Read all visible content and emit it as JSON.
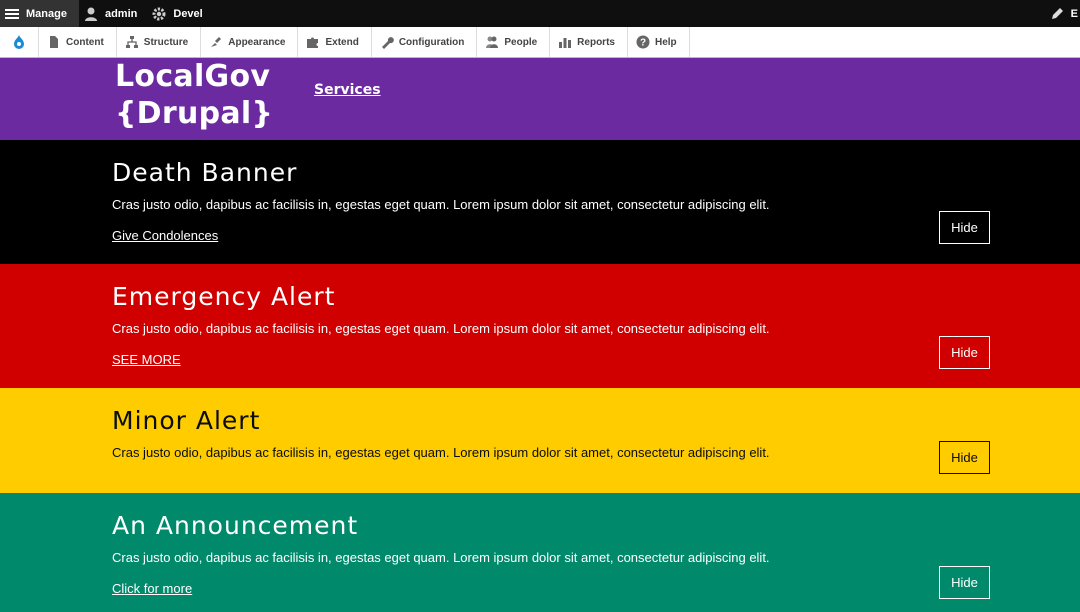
{
  "toolbar": {
    "manage_label": "Manage",
    "user_label": "admin",
    "devel_label": "Devel",
    "edit_label": "E",
    "tray": [
      {
        "label": "Content",
        "icon": "file-icon"
      },
      {
        "label": "Structure",
        "icon": "sitemap-icon"
      },
      {
        "label": "Appearance",
        "icon": "brush-icon"
      },
      {
        "label": "Extend",
        "icon": "puzzle-icon"
      },
      {
        "label": "Configuration",
        "icon": "wrench-icon"
      },
      {
        "label": "People",
        "icon": "people-icon"
      },
      {
        "label": "Reports",
        "icon": "bar-chart-icon"
      },
      {
        "label": "Help",
        "icon": "help-icon"
      }
    ]
  },
  "header": {
    "logo_line1": "LocalGov",
    "logo_line2": "{Drupal}",
    "nav_services": "Services"
  },
  "alerts": {
    "death": {
      "title": "Death Banner",
      "body": "Cras justo odio, dapibus ac facilisis in, egestas eget quam. Lorem ipsum dolor sit amet, consectetur adipiscing elit.",
      "link": "Give Condolences",
      "hide": "Hide"
    },
    "emergency": {
      "title": "Emergency Alert",
      "body": "Cras justo odio, dapibus ac facilisis in, egestas eget quam. Lorem ipsum dolor sit amet, consectetur adipiscing elit.",
      "link": "SEE MORE",
      "hide": "Hide"
    },
    "minor": {
      "title": "Minor Alert",
      "body": "Cras justo odio, dapibus ac facilisis in, egestas eget quam. Lorem ipsum dolor sit amet, consectetur adipiscing elit.",
      "hide": "Hide"
    },
    "announcement": {
      "title": "An Announcement",
      "body": "Cras justo odio, dapibus ac facilisis in, egestas eget quam. Lorem ipsum dolor sit amet, consectetur adipiscing elit.",
      "link": "Click for more",
      "hide": "Hide"
    }
  },
  "colors": {
    "header_purple": "#6b2aa0",
    "death_black": "#000000",
    "emergency_red": "#d00000",
    "minor_yellow": "#ffcc00",
    "announcement_green": "#00896a"
  }
}
